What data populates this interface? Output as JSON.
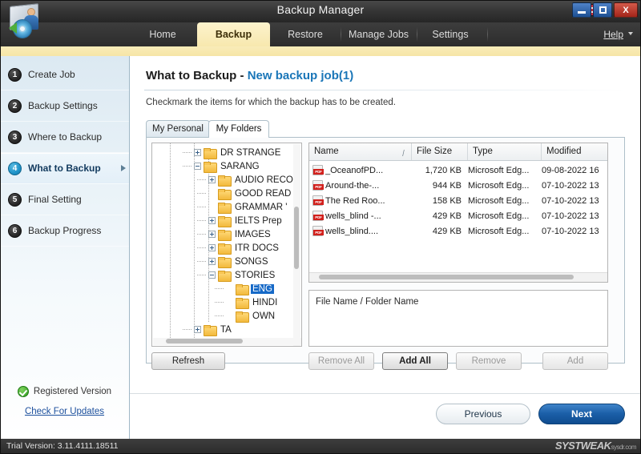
{
  "window": {
    "title": "Backup Manager",
    "logo_icon": "backup-manager-logo-icon",
    "language_flag": "us-flag-icon",
    "minimize_label": "",
    "maximize_label": "",
    "close_label": "X"
  },
  "nav": {
    "tabs": [
      {
        "label": "Home",
        "active": false
      },
      {
        "label": "Backup",
        "active": true
      },
      {
        "label": "Restore",
        "active": false
      },
      {
        "label": "Manage Jobs",
        "active": false
      },
      {
        "label": "Settings",
        "active": false
      }
    ],
    "help_label": "Help"
  },
  "sidebar": {
    "steps": [
      {
        "number": "1",
        "label": "Create Job",
        "active": false
      },
      {
        "number": "2",
        "label": "Backup Settings",
        "active": false
      },
      {
        "number": "3",
        "label": "Where to Backup",
        "active": false
      },
      {
        "number": "4",
        "label": "What to Backup",
        "active": true
      },
      {
        "number": "5",
        "label": "Final Setting",
        "active": false
      },
      {
        "number": "6",
        "label": "Backup Progress",
        "active": false
      }
    ],
    "registered_label": "Registered Version",
    "registered_icon": "green-check-icon",
    "updates_link": "Check For Updates"
  },
  "page": {
    "title_main": "What to Backup",
    "title_sep": " - ",
    "title_accent": "New backup job(1)",
    "subtitle": "Checkmark the items for which the backup has to be created."
  },
  "inner_tabs": [
    {
      "label": "My Personal",
      "active": false
    },
    {
      "label": "My Folders",
      "active": true
    }
  ],
  "tree": {
    "nodes": [
      {
        "label": "DR STRANGE",
        "depth": 2,
        "expander": "plus",
        "selected": false
      },
      {
        "label": "SARANG",
        "depth": 2,
        "expander": "minus",
        "selected": false
      },
      {
        "label": "AUDIO RECO",
        "depth": 3,
        "expander": "plus",
        "selected": false
      },
      {
        "label": "GOOD READ",
        "depth": 3,
        "expander": "none",
        "selected": false
      },
      {
        "label": "GRAMMAR '",
        "depth": 3,
        "expander": "none",
        "selected": false
      },
      {
        "label": "IELTS Prep",
        "depth": 3,
        "expander": "plus",
        "selected": false
      },
      {
        "label": "IMAGES",
        "depth": 3,
        "expander": "plus",
        "selected": false
      },
      {
        "label": "ITR DOCS",
        "depth": 3,
        "expander": "plus",
        "selected": false
      },
      {
        "label": "SONGS",
        "depth": 3,
        "expander": "plus",
        "selected": false
      },
      {
        "label": "STORIES",
        "depth": 3,
        "expander": "minus",
        "selected": false
      },
      {
        "label": "ENG",
        "depth": 4,
        "expander": "none",
        "selected": true
      },
      {
        "label": "HINDI",
        "depth": 4,
        "expander": "none",
        "selected": false
      },
      {
        "label": "OWN",
        "depth": 4,
        "expander": "none",
        "selected": false
      },
      {
        "label": "TA",
        "depth": 2,
        "expander": "plus",
        "selected": false
      }
    ]
  },
  "filelist": {
    "columns": [
      {
        "key": "name",
        "label": "Name",
        "sorted": true,
        "sort_glyph": "/"
      },
      {
        "key": "size",
        "label": "File Size",
        "sorted": false,
        "sort_glyph": ""
      },
      {
        "key": "type",
        "label": "Type",
        "sorted": false,
        "sort_glyph": ""
      },
      {
        "key": "modified",
        "label": "Modified",
        "sorted": false,
        "sort_glyph": ""
      }
    ],
    "rows": [
      {
        "icon": "pdf-file-icon",
        "name": "_OceanofPD...",
        "size": "1,720 KB",
        "type": "Microsoft Edg...",
        "modified": "09-08-2022 16"
      },
      {
        "icon": "pdf-file-icon",
        "name": "Around-the-...",
        "size": "944 KB",
        "type": "Microsoft Edg...",
        "modified": "07-10-2022 13"
      },
      {
        "icon": "pdf-file-icon",
        "name": "The Red Roo...",
        "size": "158 KB",
        "type": "Microsoft Edg...",
        "modified": "07-10-2022 13"
      },
      {
        "icon": "pdf-file-icon",
        "name": "wells_blind -...",
        "size": "429 KB",
        "type": "Microsoft Edg...",
        "modified": "07-10-2022 13"
      },
      {
        "icon": "pdf-file-icon",
        "name": "wells_blind....",
        "size": "429 KB",
        "type": "Microsoft Edg...",
        "modified": "07-10-2022 13"
      }
    ]
  },
  "selection_panel": {
    "placeholder_label": "File Name / Folder Name",
    "items": []
  },
  "actions": {
    "refresh": {
      "label": "Refresh",
      "enabled": true,
      "strong": false
    },
    "remove_all": {
      "label": "Remove All",
      "enabled": false,
      "strong": false
    },
    "add_all": {
      "label": "Add All",
      "enabled": true,
      "strong": true
    },
    "remove": {
      "label": "Remove",
      "enabled": false,
      "strong": false
    },
    "add": {
      "label": "Add",
      "enabled": false,
      "strong": false
    }
  },
  "footer": {
    "previous_label": "Previous",
    "next_label": "Next"
  },
  "status": {
    "text": "Trial Version: 3.11.4111.18511",
    "watermark": "SYSTWEAK",
    "watermark_sub": "sysdr.com"
  }
}
